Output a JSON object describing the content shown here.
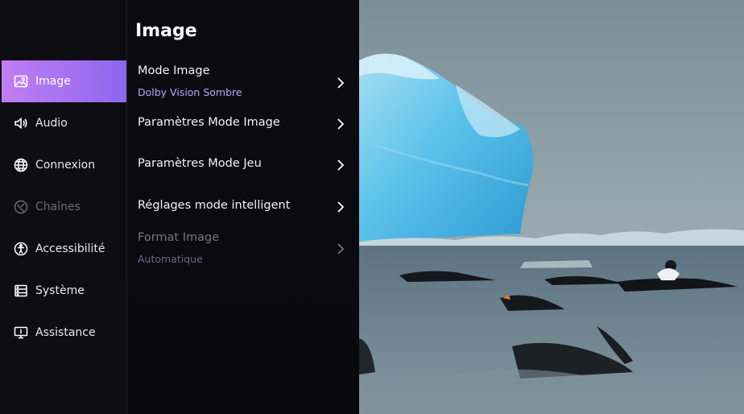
{
  "nav": {
    "items": [
      {
        "label": "Image",
        "icon": "image-icon",
        "state": "active"
      },
      {
        "label": "Audio",
        "icon": "speaker-icon",
        "state": "normal"
      },
      {
        "label": "Connexion",
        "icon": "globe-icon",
        "state": "normal"
      },
      {
        "label": "Chaînes",
        "icon": "satellite-icon",
        "state": "disabled"
      },
      {
        "label": "Accessibilité",
        "icon": "accessibility-icon",
        "state": "normal"
      },
      {
        "label": "Système",
        "icon": "system-icon",
        "state": "normal"
      },
      {
        "label": "Assistance",
        "icon": "monitor-icon",
        "state": "normal"
      }
    ]
  },
  "panel": {
    "title": "Image",
    "rows": [
      {
        "label": "Mode Image",
        "value": "Dolby Vision Sombre",
        "state": "normal"
      },
      {
        "label": "Paramètres Mode Image",
        "value": "",
        "state": "normal"
      },
      {
        "label": "Paramètres Mode Jeu",
        "value": "",
        "state": "normal"
      },
      {
        "label": "Réglages mode intelligent",
        "value": "",
        "state": "normal"
      },
      {
        "label": "Format Image",
        "value": "Automatique",
        "state": "disabled"
      }
    ]
  },
  "colors": {
    "accent_start": "#c27df2",
    "accent_end": "#8b67f0",
    "value_text": "#b9a6ff",
    "background": "#0a0a0c"
  }
}
